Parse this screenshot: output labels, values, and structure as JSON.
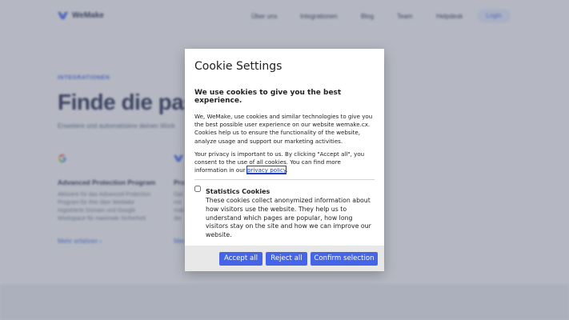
{
  "nav": {
    "brand": "WeMake",
    "links": [
      "Über uns",
      "Integrationen",
      "Blog",
      "Team",
      "Helpdesk"
    ],
    "login": "Login"
  },
  "hero": {
    "eyebrow": "INTEGRATIONEN",
    "title": "Finde die pass",
    "subtitle": "Erweitere und automatisiere deinen Work"
  },
  "cards": [
    {
      "icon": "google-icon",
      "title": "Advanced Protection Program",
      "description": "Aktiviere für das Advanced Protection Program für ihre über WeMake registrierte Domain und Google Workspace für maximale Sicherheit",
      "link": "Mehr erfahren  ›"
    },
    {
      "icon": "wemake-logo-icon",
      "title": "Pro",
      "description": "Opt\nmit\nmak\ndie",
      "link": "Mer"
    }
  ],
  "dialog": {
    "title": "Cookie Settings",
    "heading": "We use cookies to give you the best experience.",
    "intro": "We,     WeMake, use cookies and similar technologies to give you the best possible user experience on our website wemake.cx. Cookies help us to ensure the functionality of the website, analyze usage and support our marketing activities.",
    "privacy_text": "Your privacy is important to us. By clicking \"Accept all\", you consent to the use of all cookies. You can find more information in our ",
    "privacy_link": "privacy policy",
    "privacy_end": ".",
    "option": {
      "title": "Statistics Cookies",
      "description": "These cookies collect anonymized information about how visitors use the website. They help us to understand which pages are popular, how long visitors stay on the site and how we can improve our website.",
      "checked": false
    },
    "buttons": {
      "accept_all": "Accept all",
      "reject_all": "Reject all",
      "confirm": "Confirm selection"
    }
  },
  "colors": {
    "accent": "#4565e8",
    "brand_dark": "#1c1f4a",
    "overlay": "#696e80"
  }
}
